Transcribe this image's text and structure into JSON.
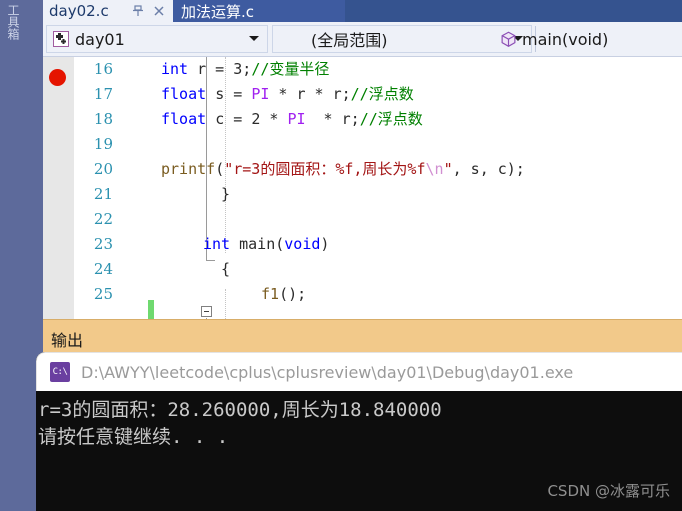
{
  "toolbox": {
    "label": "工具箱"
  },
  "tabs": [
    {
      "title": "day02.c",
      "state": "active",
      "pin_icon": "pin-icon",
      "close_icon": "close-icon"
    },
    {
      "title": "加法运算.c",
      "state": "selected"
    }
  ],
  "navbar": {
    "project": {
      "label": "day01",
      "icon": "project-icon",
      "arrow": "chevron-down-icon"
    },
    "scope": {
      "label": "(全局范围)",
      "arrow": "chevron-down-icon"
    },
    "member": {
      "label": "main(void)",
      "icon": "method-cube-icon"
    }
  },
  "editor": {
    "breakpoint_line": 16,
    "lines": [
      {
        "no": "16",
        "indent": 118,
        "tokens": [
          {
            "t": "int",
            "c": "kw"
          },
          {
            "t": " ",
            "c": "plain"
          },
          {
            "t": "r",
            "c": "id"
          },
          {
            "t": " = ",
            "c": "plain"
          },
          {
            "t": "3",
            "c": "plain"
          },
          {
            "t": ";",
            "c": "plain"
          },
          {
            "t": "//变量半径",
            "c": "cmt"
          }
        ]
      },
      {
        "no": "17",
        "indent": 118,
        "tokens": [
          {
            "t": "float",
            "c": "kw"
          },
          {
            "t": " ",
            "c": "plain"
          },
          {
            "t": "s",
            "c": "id"
          },
          {
            "t": " = ",
            "c": "plain"
          },
          {
            "t": "PI",
            "c": "macro"
          },
          {
            "t": " * ",
            "c": "plain"
          },
          {
            "t": "r",
            "c": "id"
          },
          {
            "t": " * ",
            "c": "plain"
          },
          {
            "t": "r",
            "c": "id"
          },
          {
            "t": ";",
            "c": "plain"
          },
          {
            "t": "//浮点数",
            "c": "cmt"
          }
        ]
      },
      {
        "no": "18",
        "indent": 118,
        "tokens": [
          {
            "t": "float",
            "c": "kw"
          },
          {
            "t": " ",
            "c": "plain"
          },
          {
            "t": "c",
            "c": "id"
          },
          {
            "t": " = ",
            "c": "plain"
          },
          {
            "t": "2",
            "c": "plain"
          },
          {
            "t": " * ",
            "c": "plain"
          },
          {
            "t": "PI",
            "c": "macro"
          },
          {
            "t": "  * ",
            "c": "plain"
          },
          {
            "t": "r",
            "c": "id"
          },
          {
            "t": ";",
            "c": "plain"
          },
          {
            "t": "//浮点数",
            "c": "cmt"
          }
        ]
      },
      {
        "no": "19",
        "indent": 118,
        "tokens": []
      },
      {
        "no": "20",
        "indent": 118,
        "tokens": [
          {
            "t": "printf",
            "c": "fn"
          },
          {
            "t": "(",
            "c": "paren"
          },
          {
            "t": "\"r=3的圆面积：%f,周长为%f",
            "c": "str"
          },
          {
            "t": "\\n",
            "c": "esc"
          },
          {
            "t": "\"",
            "c": "str"
          },
          {
            "t": ", ",
            "c": "plain"
          },
          {
            "t": "s",
            "c": "id"
          },
          {
            "t": ", ",
            "c": "plain"
          },
          {
            "t": "c",
            "c": "id"
          },
          {
            "t": ");",
            "c": "paren"
          }
        ]
      },
      {
        "no": "21",
        "indent": 178,
        "tokens": [
          {
            "t": "}",
            "c": "plain"
          }
        ]
      },
      {
        "no": "22",
        "indent": 118,
        "tokens": []
      },
      {
        "no": "23",
        "indent": 160,
        "tokens": [
          {
            "t": "int",
            "c": "kw"
          },
          {
            "t": " ",
            "c": "plain"
          },
          {
            "t": "main",
            "c": "plain"
          },
          {
            "t": "(",
            "c": "paren"
          },
          {
            "t": "void",
            "c": "kw"
          },
          {
            "t": ")",
            "c": "paren"
          }
        ]
      },
      {
        "no": "24",
        "indent": 178,
        "tokens": [
          {
            "t": "{",
            "c": "plain"
          }
        ]
      },
      {
        "no": "25",
        "indent": 218,
        "tokens": [
          {
            "t": "f1",
            "c": "fn"
          },
          {
            "t": "();",
            "c": "paren"
          }
        ]
      }
    ]
  },
  "output": {
    "title": "输出"
  },
  "console": {
    "icon_label": "C:\\",
    "path": "D:\\AWYY\\leetcode\\cplus\\cplusreview\\day01\\Debug\\day01.exe",
    "lines": [
      "r=3的圆面积：28.260000,周长为18.840000",
      "请按任意键继续. . ."
    ],
    "watermark": "CSDN @冰露可乐"
  },
  "colors": {
    "vs_chrome": "#5d6a9b",
    "tab_selected": "#3e5ba0",
    "output_header": "#f2c98a",
    "breakpoint_red": "#e51400",
    "change_green": "#6fd96f",
    "console_bg": "#0d0d0d"
  }
}
